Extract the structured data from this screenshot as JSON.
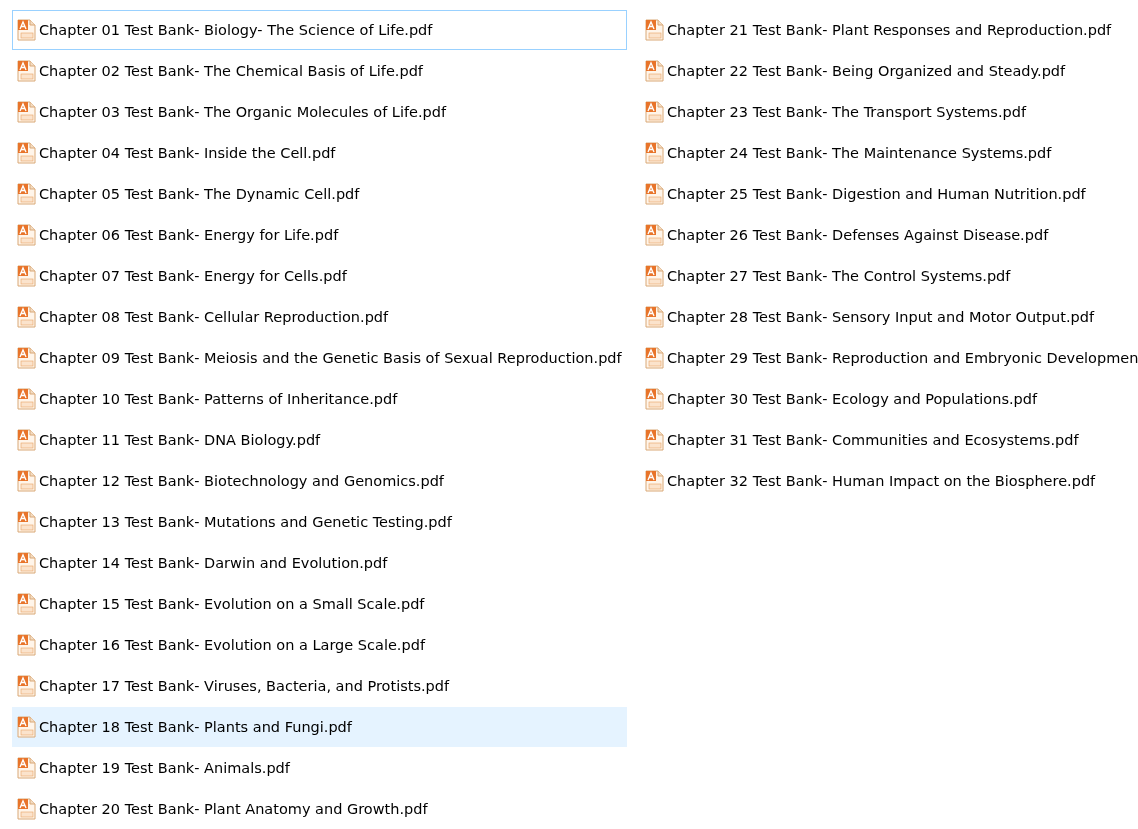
{
  "files": [
    {
      "name": "Chapter 01 Test Bank- Biology- The Science of Life.pdf",
      "focused": true,
      "hovered": false
    },
    {
      "name": "Chapter 02 Test Bank- The Chemical Basis of Life.pdf",
      "focused": false,
      "hovered": false
    },
    {
      "name": "Chapter 03 Test Bank- The Organic Molecules of Life.pdf",
      "focused": false,
      "hovered": false
    },
    {
      "name": "Chapter 04 Test Bank- Inside the Cell.pdf",
      "focused": false,
      "hovered": false
    },
    {
      "name": "Chapter 05 Test Bank- The Dynamic Cell.pdf",
      "focused": false,
      "hovered": false
    },
    {
      "name": "Chapter 06 Test Bank- Energy for Life.pdf",
      "focused": false,
      "hovered": false
    },
    {
      "name": "Chapter 07 Test Bank- Energy for Cells.pdf",
      "focused": false,
      "hovered": false
    },
    {
      "name": "Chapter 08 Test Bank- Cellular Reproduction.pdf",
      "focused": false,
      "hovered": false
    },
    {
      "name": "Chapter 09 Test Bank- Meiosis and the Genetic Basis of Sexual Reproduction.pdf",
      "focused": false,
      "hovered": false
    },
    {
      "name": "Chapter 10 Test Bank- Patterns of Inheritance.pdf",
      "focused": false,
      "hovered": false
    },
    {
      "name": "Chapter 11 Test Bank- DNA Biology.pdf",
      "focused": false,
      "hovered": false
    },
    {
      "name": "Chapter 12 Test Bank- Biotechnology and Genomics.pdf",
      "focused": false,
      "hovered": false
    },
    {
      "name": "Chapter 13 Test Bank- Mutations and Genetic Testing.pdf",
      "focused": false,
      "hovered": false
    },
    {
      "name": "Chapter 14 Test Bank- Darwin and Evolution.pdf",
      "focused": false,
      "hovered": false
    },
    {
      "name": "Chapter 15 Test Bank- Evolution on a Small Scale.pdf",
      "focused": false,
      "hovered": false
    },
    {
      "name": "Chapter 16 Test Bank- Evolution on a Large Scale.pdf",
      "focused": false,
      "hovered": false
    },
    {
      "name": "Chapter 17 Test Bank- Viruses, Bacteria, and Protists.pdf",
      "focused": false,
      "hovered": false
    },
    {
      "name": "Chapter 18 Test Bank- Plants and Fungi.pdf",
      "focused": false,
      "hovered": true
    },
    {
      "name": "Chapter 19 Test Bank- Animals.pdf",
      "focused": false,
      "hovered": false
    },
    {
      "name": "Chapter 20 Test Bank- Plant Anatomy and Growth.pdf",
      "focused": false,
      "hovered": false
    },
    {
      "name": "Chapter 21 Test Bank- Plant Responses and Reproduction.pdf",
      "focused": false,
      "hovered": false
    },
    {
      "name": "Chapter 22 Test Bank- Being Organized and Steady.pdf",
      "focused": false,
      "hovered": false
    },
    {
      "name": "Chapter 23 Test Bank- The Transport Systems.pdf",
      "focused": false,
      "hovered": false
    },
    {
      "name": "Chapter 24 Test Bank- The Maintenance Systems.pdf",
      "focused": false,
      "hovered": false
    },
    {
      "name": "Chapter 25 Test Bank- Digestion and Human Nutrition.pdf",
      "focused": false,
      "hovered": false
    },
    {
      "name": "Chapter 26 Test Bank- Defenses Against Disease.pdf",
      "focused": false,
      "hovered": false
    },
    {
      "name": "Chapter 27 Test Bank- The Control Systems.pdf",
      "focused": false,
      "hovered": false
    },
    {
      "name": "Chapter 28 Test Bank- Sensory Input and Motor Output.pdf",
      "focused": false,
      "hovered": false
    },
    {
      "name": "Chapter 29 Test Bank- Reproduction and Embryonic Developmen",
      "focused": false,
      "hovered": false
    },
    {
      "name": "Chapter 30 Test Bank- Ecology and Populations.pdf",
      "focused": false,
      "hovered": false
    },
    {
      "name": "Chapter 31 Test Bank- Communities and Ecosystems.pdf",
      "focused": false,
      "hovered": false
    },
    {
      "name": "Chapter 32 Test Bank- Human Impact on the Biosphere.pdf",
      "focused": false,
      "hovered": false
    }
  ]
}
